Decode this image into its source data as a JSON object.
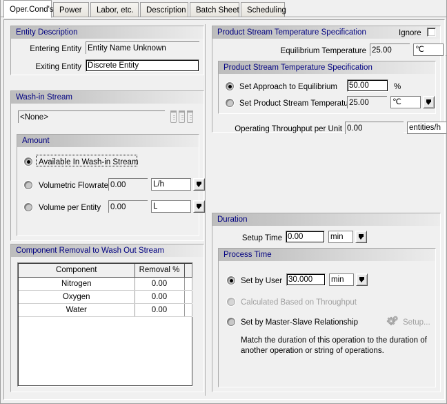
{
  "window": {
    "title": "Oper.Cond's"
  },
  "tabs": [
    {
      "label": "Oper.Cond's",
      "active": true
    },
    {
      "label": "Power",
      "active": false
    },
    {
      "label": "Labor, etc.",
      "active": false
    },
    {
      "label": "Description",
      "active": false
    },
    {
      "label": "Batch Sheet",
      "active": false
    },
    {
      "label": "Scheduling",
      "active": false
    }
  ],
  "entity_description": {
    "header": "Entity Description",
    "entering_entity_label": "Entering Entity",
    "entering_entity_value": "Entity Name Unknown",
    "exiting_entity_label": "Exiting Entity",
    "exiting_entity_value": "Discrete Entity"
  },
  "wash_in_stream": {
    "header": "Wash-in Stream",
    "stream_value": "<None>",
    "amount": {
      "header": "Amount",
      "option_available_label": "Available In Wash-in Stream",
      "option_volumetric_label": "Volumetric Flowrate",
      "volumetric_value": "0.00",
      "volumetric_unit": "L/h",
      "option_volume_per_entity_label": "Volume per Entity",
      "volume_per_entity_value": "0.00",
      "volume_per_entity_unit": "L",
      "selected": "available"
    }
  },
  "component_removal": {
    "header": "Component Removal to Wash Out Stream",
    "columns": [
      "Component",
      "Removal %"
    ],
    "rows": [
      {
        "component": "Nitrogen",
        "removal": "0.00"
      },
      {
        "component": "Oxygen",
        "removal": "0.00"
      },
      {
        "component": "Water",
        "removal": "0.00"
      }
    ]
  },
  "product_stream": {
    "header": "Product Stream Temperature Specification",
    "ignore_label": "Ignore",
    "ignore_checked": false,
    "equilibrium_label": "Equilibrium Temperature",
    "equilibrium_value": "25.00",
    "equilibrium_unit": "℃",
    "inner": {
      "header": "Product Stream Temperature Specification",
      "option_approach_label": "Set Approach to Equilibrium",
      "approach_value": "50.00",
      "approach_unit": "%",
      "option_product_temp_label": "Set Product Stream Temperature",
      "product_temp_value": "25.00",
      "product_temp_unit": "℃",
      "selected": "approach"
    },
    "throughput_label": "Operating Throughput per Unit",
    "throughput_value": "0.00",
    "throughput_unit": "entities/h"
  },
  "duration": {
    "header": "Duration",
    "setup_time_label": "Setup Time",
    "setup_time_value": "0.00",
    "setup_time_unit": "min",
    "process_time": {
      "header": "Process Time",
      "option_user_label": "Set by User",
      "user_value": "30.000",
      "user_unit": "min",
      "option_calculated_label": "Calculated Based on Throughput",
      "option_master_slave_label": "Set by Master-Slave Relationship",
      "setup_button_label": "Setup...",
      "hint": "Match the duration of this operation to the duration of\nanother operation or string of operations.",
      "selected": "user"
    }
  },
  "colors": {
    "header_text": "#000080",
    "face": "#f0f0f0",
    "header_grad_start": "#bdbdbd",
    "disabled_text": "#a0a0a0"
  }
}
